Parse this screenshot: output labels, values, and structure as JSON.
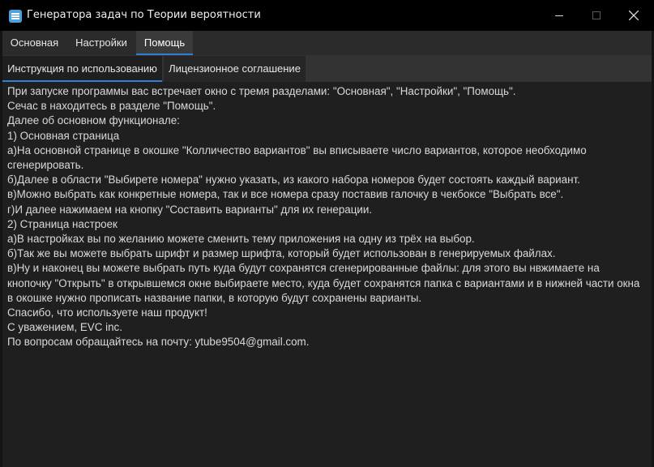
{
  "window": {
    "title": "Генератора задач по Теории вероятности",
    "accent": "#2d7fd8"
  },
  "main_tabs": [
    {
      "label": "Основная",
      "selected": false
    },
    {
      "label": "Настройки",
      "selected": false
    },
    {
      "label": "Помощь",
      "selected": true
    }
  ],
  "sub_tabs": [
    {
      "label": "Инструкция по использованию",
      "selected": true
    },
    {
      "label": "Лицензионное соглашение",
      "selected": false
    }
  ],
  "instructions": {
    "lines": [
      "При запуске программы вас встречает окно с тремя разделами: \"Основная\", \"Настройки\", \"Помощь\".",
      "Сечас в находитесь в разделе \"Помощь\".",
      "Далее об основном функционале:",
      "1) Основная страница",
      "а)На основной странице в окошке \"Колличество вариантов\" вы вписываете число вариантов, которое необходимо сгенерировать.",
      "б)Далее в области \"Выбирете номера\" нужно указать, из какого набора номеров будет состоять каждый вариант.",
      "в)Можно выбрать как конкретные номера, так и все номера сразу поставив галочку в чекбоксе \"Выбрать все\".",
      "г)И далее нажимаем на кнопку \"Составить варианты\" для их генерации.",
      "2) Страница настроек",
      "а)В настройках вы по желанию можете сменить тему приложения на одну из трёх на выбор.",
      "б)Так же вы можете выбрать шрифт и размер шрифта, который будет использован в генерируемых файлах.",
      "в)Ну и наконец вы можете выбрать путь куда будут сохранятся сгенерированные файлы: для этого вы нвжимаете на кнопочку \"Открыть\" в открывшемся окне выбираете место, куда будет сохранятся папка с вариантами и в нижней части окна в окошке нужно прописать название папки, в которую будут сохранены варианты.",
      "Спасибо, что используете наш продукт!",
      "С уважением, EVC inc.",
      "По вопросам обращайтесь на почту: ytube9504@gmail.com."
    ]
  }
}
